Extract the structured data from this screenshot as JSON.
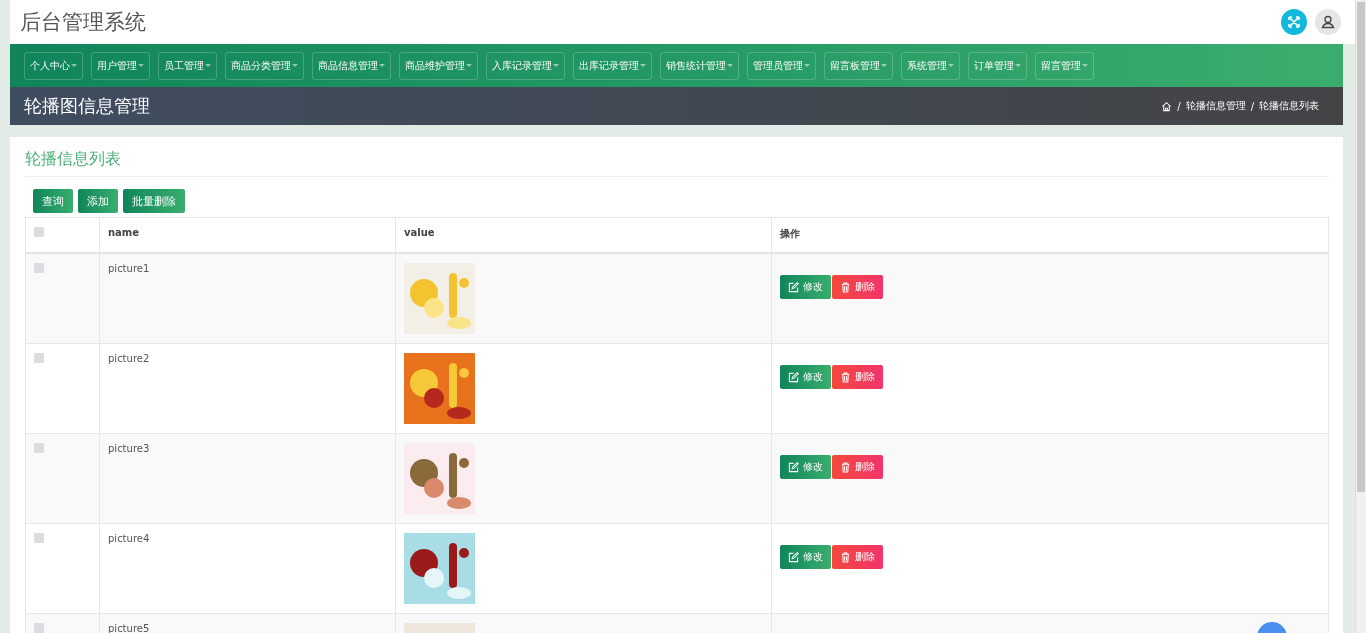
{
  "header": {
    "title": "后台管理系统"
  },
  "nav": [
    {
      "label": "个人中心"
    },
    {
      "label": "用户管理"
    },
    {
      "label": "员工管理"
    },
    {
      "label": "商品分类管理"
    },
    {
      "label": "商品信息管理"
    },
    {
      "label": "商品维护管理"
    },
    {
      "label": "入库记录管理"
    },
    {
      "label": "出库记录管理"
    },
    {
      "label": "销售统计管理"
    },
    {
      "label": "管理员管理"
    },
    {
      "label": "留言板管理"
    },
    {
      "label": "系统管理"
    },
    {
      "label": "订单管理"
    },
    {
      "label": "留言管理"
    }
  ],
  "banner": {
    "title": "轮播图信息管理",
    "breadcrumb": [
      "轮播信息管理",
      "轮播信息列表"
    ],
    "separator": "/"
  },
  "panel": {
    "title": "轮播信息列表",
    "buttons": [
      "查询",
      "添加",
      "批量删除"
    ]
  },
  "table": {
    "columns": [
      "name",
      "value",
      "操作"
    ],
    "header_checked": false,
    "rows": [
      {
        "checked": false,
        "name": "picture1",
        "value": {
          "kind": "picture"
        },
        "actions": [
          "修改",
          "删除"
        ]
      },
      {
        "checked": false,
        "name": "picture2",
        "value": {
          "kind": "picture"
        },
        "actions": [
          "修改",
          "删除"
        ]
      },
      {
        "checked": false,
        "name": "picture3",
        "value": {
          "kind": "picture"
        },
        "actions": [
          "修改",
          "删除"
        ]
      },
      {
        "checked": false,
        "name": "picture4",
        "value": {
          "kind": "picture"
        },
        "actions": [
          "修改",
          "删除"
        ]
      },
      {
        "checked": false,
        "name": "picture5",
        "value": {
          "kind": "picture"
        }
      }
    ]
  }
}
